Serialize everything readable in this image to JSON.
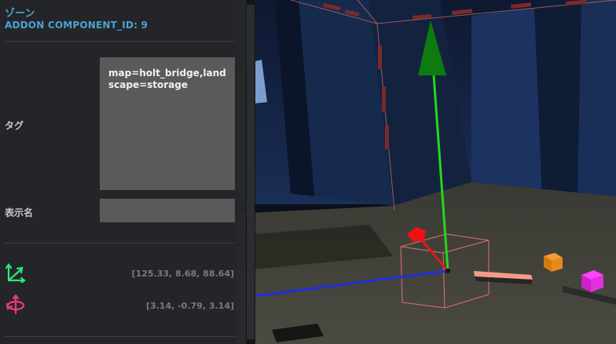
{
  "panel": {
    "title": "ゾーン",
    "subtitle": "ADDON COMPONENT_ID: 9",
    "tag_label": "タグ",
    "tag_value": "map=holt_bridge,landscape=storage",
    "display_name_label": "表示名",
    "display_name_value": "",
    "position_value": "[125.33, 8.68, 88.64]",
    "rotation_value": "[3.14, -0.79, 3.14]"
  },
  "icons": {
    "position": "move-axes-icon",
    "rotation": "rotate-icon"
  },
  "colors": {
    "header": "#4aa3d4",
    "position_icon": "#2ee87a",
    "rotation_icon": "#e83a8a",
    "gizmo_x": "#1f2fe0",
    "gizmo_y": "#22d81c",
    "gizmo_z": "#e01818"
  }
}
